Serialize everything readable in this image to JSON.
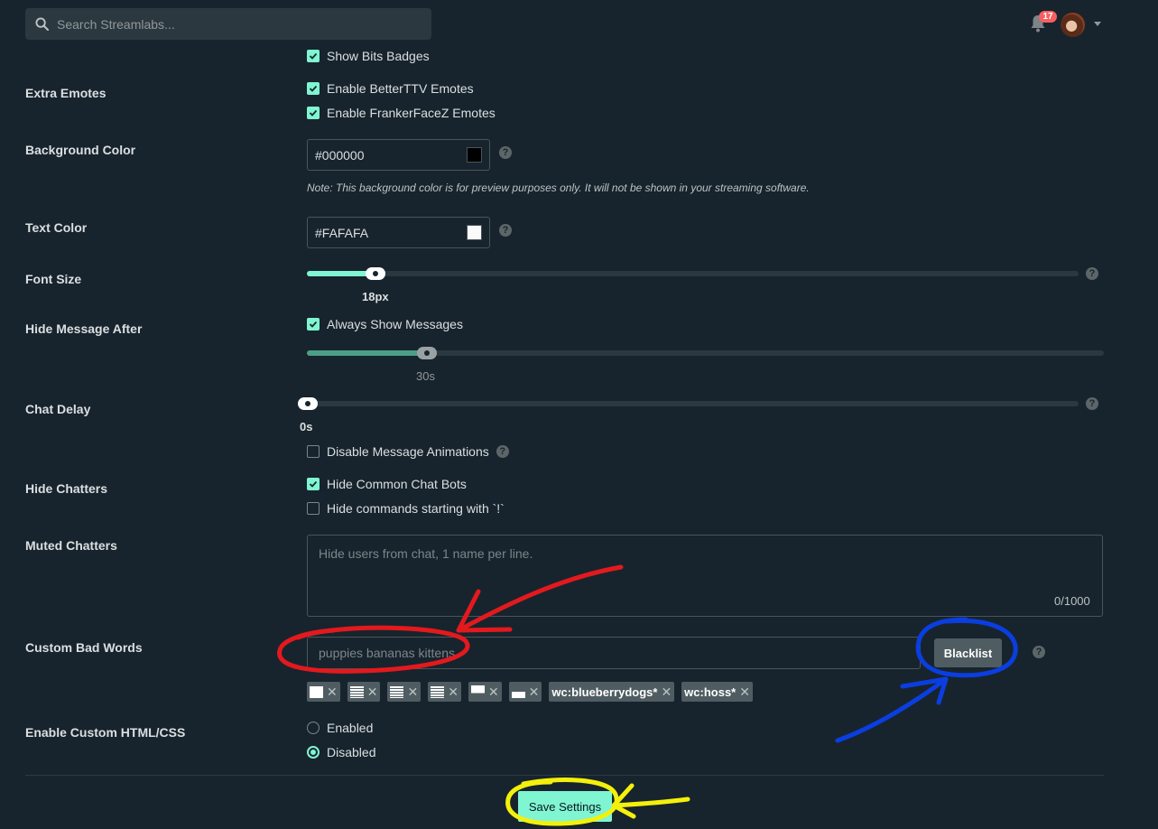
{
  "topbar": {
    "search_placeholder": "Search Streamlabs...",
    "notification_count": "17"
  },
  "checkbox_partial": {
    "label": "Show Bits Badges",
    "checked": true
  },
  "extra_emotes": {
    "label": "Extra Emotes",
    "options": [
      {
        "label": "Enable BetterTTV Emotes",
        "checked": true
      },
      {
        "label": "Enable FrankerFaceZ Emotes",
        "checked": true
      }
    ]
  },
  "background_color": {
    "label": "Background Color",
    "value": "#000000",
    "note": "Note: This background color is for preview purposes only. It will not be shown in your streaming software."
  },
  "text_color": {
    "label": "Text Color",
    "value": "#FAFAFA"
  },
  "font_size": {
    "label": "Font Size",
    "value_text": "18px",
    "fraction": 0.09
  },
  "hide_message_after": {
    "label": "Hide Message After",
    "checkbox_label": "Always Show Messages",
    "checked": true,
    "value_text": "30s",
    "fraction": 0.15
  },
  "chat_delay": {
    "label": "Chat Delay",
    "value_text": "0s",
    "fraction": 0,
    "animations_label": "Disable Message Animations",
    "animations_checked": false
  },
  "hide_chatters": {
    "label": "Hide Chatters",
    "options": [
      {
        "label": "Hide Common Chat Bots",
        "checked": true
      },
      {
        "label": "Hide commands starting with `!`",
        "checked": false
      }
    ]
  },
  "muted_chatters": {
    "label": "Muted Chatters",
    "placeholder": "Hide users from chat, 1 name per line.",
    "counter": "0/1000"
  },
  "custom_bad_words": {
    "label": "Custom Bad Words",
    "placeholder": "puppies bananas kittens",
    "button_label": "Blacklist",
    "tags": [
      "wc:blueberrydogs*",
      "wc:hoss*"
    ]
  },
  "custom_html": {
    "label": "Enable Custom HTML/CSS",
    "options": [
      {
        "label": "Enabled",
        "selected": false
      },
      {
        "label": "Disabled",
        "selected": true
      }
    ]
  },
  "save_label": "Save Settings",
  "colors": {
    "accent": "#80f5d2",
    "background": "#17242d",
    "annotation_red": "#e3191e",
    "annotation_blue": "#0b3ee0",
    "annotation_yellow": "#f4f00b"
  }
}
